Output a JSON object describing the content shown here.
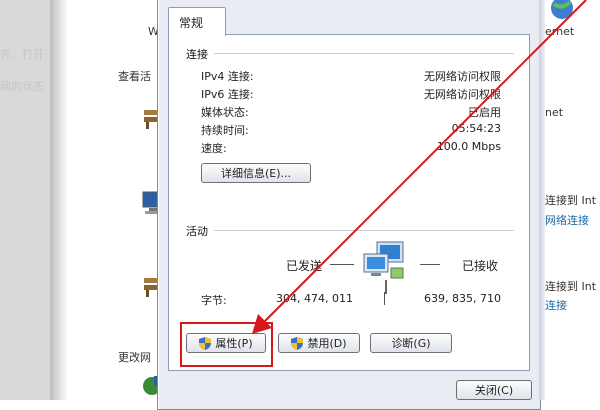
{
  "background": {
    "left_fragments": [
      "先，打开",
      "网的状态"
    ],
    "left_panel_labels": [
      "查看活",
      "更改网"
    ],
    "right_labels": [
      "ernet",
      "net",
      "连接到 Int",
      "连接到 Int"
    ],
    "right_links": [
      "网络连接",
      "连接"
    ],
    "title_fragment": "W"
  },
  "dialog": {
    "tab_label": "常规",
    "connection": {
      "section_title": "连接",
      "rows": [
        {
          "label": "IPv4 连接:",
          "value": "无网络访问权限"
        },
        {
          "label": "IPv6 连接:",
          "value": "无网络访问权限"
        },
        {
          "label": "媒体状态:",
          "value": "已启用"
        },
        {
          "label": "持续时间:",
          "value": "05:54:23"
        },
        {
          "label": "速度:",
          "value": "100.0 Mbps"
        }
      ],
      "details_button": "详细信息(E)..."
    },
    "activity": {
      "section_title": "活动",
      "sent_label": "已发送",
      "received_label": "已接收",
      "bytes_label": "字节:",
      "bytes_sent": "304, 474, 011",
      "bytes_received": "639, 835, 710"
    },
    "buttons": {
      "properties": "属性(P)",
      "disable": "禁用(D)",
      "diagnose": "诊断(G)",
      "close": "关闭(C)"
    }
  },
  "colors": {
    "highlight": "#d6181d",
    "link": "#1a6aa5"
  }
}
